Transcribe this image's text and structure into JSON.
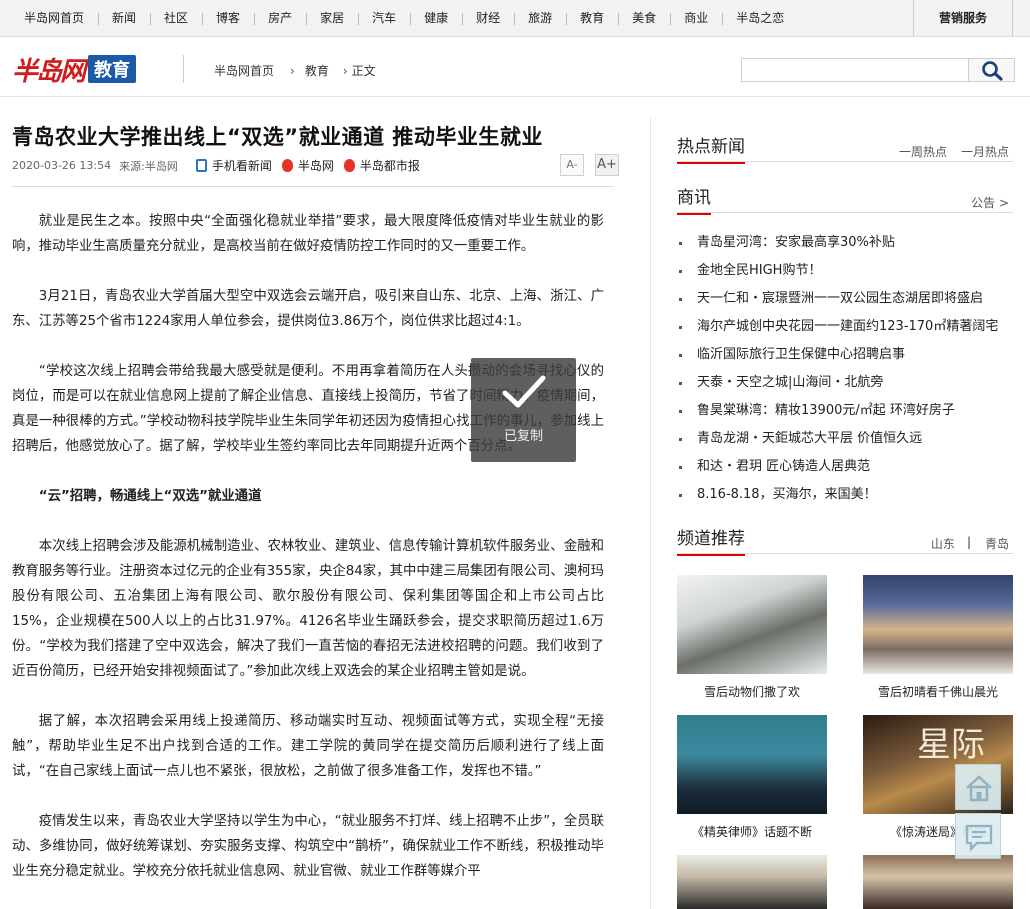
{
  "topnav": {
    "items": [
      "半岛网首页",
      "新闻",
      "社区",
      "博客",
      "房产",
      "家居",
      "汽车",
      "健康",
      "财经",
      "旅游",
      "教育",
      "美食",
      "商业",
      "半岛之恋"
    ],
    "marketing": "营销服务"
  },
  "header": {
    "logo_brand": "半岛网",
    "logo_channel": "教育",
    "breadcrumb": [
      "半岛网首页",
      "教育",
      "正文"
    ],
    "search_placeholder": ""
  },
  "article": {
    "title": "青岛农业大学推出线上“双选”就业通道 推动毕业生就业",
    "date": "2020-03-26 13:54",
    "source": "来源:半岛网",
    "share": [
      "手机看新闻",
      "半岛网",
      "半岛都市报"
    ],
    "font_small": "A-",
    "font_big": "A+",
    "paragraphs": [
      {
        "text": "就业是民生之本。按照中央“全面强化稳就业举措”要求，最大限度降低疫情对毕业生就业的影响，推动毕业生高质量充分就业，是高校当前在做好疫情防控工作同时的又一重要工作。",
        "sub": false
      },
      {
        "text": "3月21日，青岛农业大学首届大型空中双选会云端开启，吸引来自山东、北京、上海、浙江、广东、江苏等25个省市1224家用人单位参会，提供岗位3.86万个，岗位供求比超过4:1。",
        "sub": false
      },
      {
        "text": "“学校这次线上招聘会带给我最大感受就是便利。不用再拿着简历在人头攒动的会场寻找心仪的岗位，而是可以在就业信息网上提前了解企业信息、直接线上投简历，节省了时间精力。疫情期间，真是一种很棒的方式。”学校动物科技学院毕业生朱同学年初还因为疫情担心找工作的事儿，参加线上招聘后，他感觉放心了。据了解，学校毕业生签约率同比去年同期提升近两个百分点。",
        "sub": false
      },
      {
        "text": "“云”招聘，畅通线上“双选”就业通道",
        "sub": true
      },
      {
        "text": "本次线上招聘会涉及能源机械制造业、农林牧业、建筑业、信息传输计算机软件服务业、金融和教育服务等行业。注册资本过亿元的企业有355家，央企84家，其中中建三局集团有限公司、澳柯玛股份有限公司、五冶集团上海有限公司、歌尔股份有限公司、保利集团等国企和上市公司占比15%，企业规模在500人以上的占比31.97%。4126名毕业生踊跃参会，提交求职简历超过1.6万份。“学校为我们搭建了空中双选会，解决了我们一直苦恼的春招无法进校招聘的问题。我们收到了近百份简历，已经开始安排视频面试了。”参加此次线上双选会的某企业招聘主管如是说。",
        "sub": false
      },
      {
        "text": "据了解，本次招聘会采用线上投递简历、移动端实时互动、视频面试等方式，实现全程“无接触”，帮助毕业生足不出户找到合适的工作。建工学院的黄同学在提交简历后顺利进行了线上面试，“在自己家线上面试一点儿也不紧张，很放松，之前做了很多准备工作，发挥也不错。”",
        "sub": false
      },
      {
        "text": "疫情发生以来，青岛农业大学坚持以学生为中心，“就业服务不打烊、线上招聘不止步”，全员联动、多维协同，做好统筹谋划、夯实服务支撑、构筑空中“鹊桥”，确保就业工作不断线，积极推动毕业生充分稳定就业。学校充分依托就业信息网、就业官微、就业工作群等媒介平",
        "sub": false
      }
    ]
  },
  "toast": {
    "text": "已复制"
  },
  "sidebar": {
    "hot": {
      "title": "热点新闻",
      "tabs": [
        "一周热点",
        "一月热点"
      ]
    },
    "business": {
      "title": "商讯",
      "more": "公告 >",
      "items": [
        "青岛星河湾：安家最高享30%补贴",
        "金地全民HIGH购节！",
        "天一仁和・宸璟暨洲一一双公园生态湖居即将盛启",
        "海尔产城创中央花园一一建面约123-170㎡精著阔宅",
        "临沂国际旅行卫生保健中心招聘启事",
        "天泰・天空之城|山海间・北航旁",
        "鲁昊棠琳湾：精妆13900元/㎡起 环湾好房子",
        "青岛龙湖・天鉅城芯大平层 价值恒久远",
        "和达・君玥 匠心铸造人居典范",
        "8.16-8.18，买海尔，来国美！"
      ]
    },
    "channel": {
      "title": "频道推荐",
      "tabs": [
        "山东",
        "青岛"
      ],
      "cards": [
        "雪后动物们撒了欢",
        "雪后初晴看千佛山晨光",
        "《精英律师》话题不断",
        "《惊涛迷局》热映",
        "",
        ""
      ],
      "movie_text": "星际"
    }
  }
}
